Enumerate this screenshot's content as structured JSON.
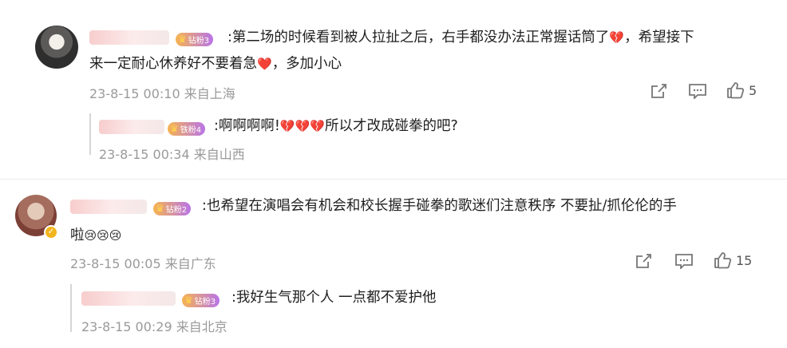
{
  "comments": [
    {
      "fan_badge": "钻粉3",
      "text_line1": ":第二场的时候看到被人拉扯之后，右手都没办法正常握话筒了",
      "emoji1": "💔",
      "text_line1_tail": "，希望接下",
      "text_line2": "来一定耐心休养好不要着急",
      "emoji2": "❤️",
      "text_line2_tail": "，多加小心",
      "time": "23-8-15 00:10",
      "location": "来自上海",
      "likes": "5",
      "reply": {
        "fan_badge": "铁粉4",
        "text": ":啊啊啊啊!",
        "emoji": "💔",
        "text_tail": "所以才改成碰拳的吧?",
        "time": "23-8-15 00:34",
        "location": "来自山西"
      }
    },
    {
      "fan_badge": "钻粉2",
      "text_line1": ":也希望在演唱会有机会和校长握手碰拳的歌迷们注意秩序 不要扯/抓伦伦的手",
      "text_line2": "啦",
      "emoji": "😢",
      "time": "23-8-15 00:05",
      "location": "来自广东",
      "likes": "15",
      "reply": {
        "fan_badge": "钻粉3",
        "text": ":我好生气那个人 一点都不爱护他",
        "time": "23-8-15 00:29",
        "location": "来自北京"
      }
    }
  ],
  "icons": {
    "share": "share-icon",
    "comment": "comment-icon",
    "like": "thumbs-up-icon",
    "crown": "crown-icon",
    "verified": "verified-badge-icon"
  },
  "colors": {
    "meta": "#9a9a9a",
    "badge_start": "#f6b352",
    "badge_end": "#b874e8"
  }
}
